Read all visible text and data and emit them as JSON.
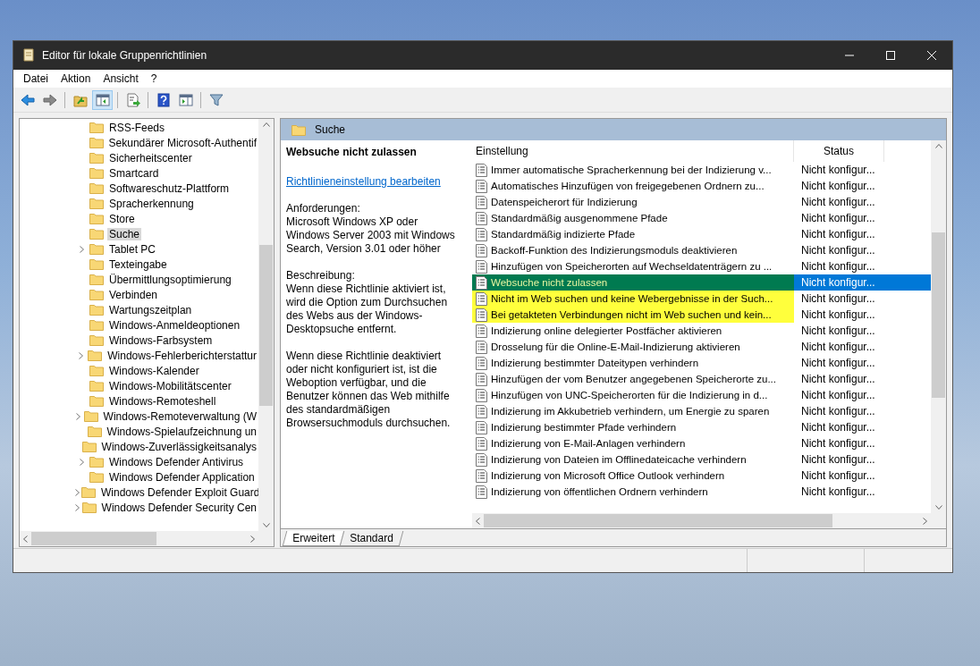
{
  "window": {
    "title": "Editor für lokale Gruppenrichtlinien"
  },
  "menu": [
    "Datei",
    "Aktion",
    "Ansicht",
    "?"
  ],
  "toolbar": [
    {
      "kind": "back",
      "pressed": false
    },
    {
      "kind": "forward",
      "pressed": false
    },
    {
      "kind": "sep"
    },
    {
      "kind": "up",
      "pressed": false
    },
    {
      "kind": "tree",
      "pressed": true
    },
    {
      "kind": "sep"
    },
    {
      "kind": "export",
      "pressed": false
    },
    {
      "kind": "sep"
    },
    {
      "kind": "help",
      "pressed": false
    },
    {
      "kind": "pane",
      "pressed": false
    },
    {
      "kind": "sep"
    },
    {
      "kind": "filter",
      "pressed": false
    }
  ],
  "tree": {
    "items": [
      {
        "label": "RSS-Feeds",
        "has_children": false,
        "selected": false
      },
      {
        "label": "Sekundärer Microsoft-Authentif",
        "has_children": false,
        "selected": false
      },
      {
        "label": "Sicherheitscenter",
        "has_children": false,
        "selected": false
      },
      {
        "label": "Smartcard",
        "has_children": false,
        "selected": false
      },
      {
        "label": "Softwareschutz-Plattform",
        "has_children": false,
        "selected": false
      },
      {
        "label": "Spracherkennung",
        "has_children": false,
        "selected": false
      },
      {
        "label": "Store",
        "has_children": false,
        "selected": false
      },
      {
        "label": "Suche",
        "has_children": false,
        "selected": true
      },
      {
        "label": "Tablet PC",
        "has_children": true,
        "selected": false
      },
      {
        "label": "Texteingabe",
        "has_children": false,
        "selected": false
      },
      {
        "label": "Übermittlungsoptimierung",
        "has_children": false,
        "selected": false
      },
      {
        "label": "Verbinden",
        "has_children": false,
        "selected": false
      },
      {
        "label": "Wartungszeitplan",
        "has_children": false,
        "selected": false
      },
      {
        "label": "Windows-Anmeldeoptionen",
        "has_children": false,
        "selected": false
      },
      {
        "label": "Windows-Farbsystem",
        "has_children": false,
        "selected": false
      },
      {
        "label": "Windows-Fehlerberichterstattur",
        "has_children": true,
        "selected": false
      },
      {
        "label": "Windows-Kalender",
        "has_children": false,
        "selected": false
      },
      {
        "label": "Windows-Mobilitätscenter",
        "has_children": false,
        "selected": false
      },
      {
        "label": "Windows-Remoteshell",
        "has_children": false,
        "selected": false
      },
      {
        "label": "Windows-Remoteverwaltung (W",
        "has_children": true,
        "selected": false
      },
      {
        "label": "Windows-Spielaufzeichnung un",
        "has_children": false,
        "selected": false
      },
      {
        "label": "Windows-Zuverlässigkeitsanalys",
        "has_children": false,
        "selected": false
      },
      {
        "label": "Windows Defender Antivirus",
        "has_children": true,
        "selected": false
      },
      {
        "label": "Windows Defender Application",
        "has_children": false,
        "selected": false
      },
      {
        "label": "Windows Defender Exploit Guard",
        "has_children": true,
        "selected": false
      },
      {
        "label": "Windows Defender Security Cen",
        "has_children": true,
        "selected": false
      }
    ]
  },
  "details": {
    "header": "Suche",
    "title": "Websuche nicht zulassen",
    "link": "Richtlinieneinstellung bearbeiten",
    "requirements_label": "Anforderungen:",
    "requirements": "Microsoft Windows XP oder Windows Server 2003 mit Windows Search, Version 3.01 oder höher",
    "description_label": "Beschreibung:",
    "description": [
      "Wenn diese Richtlinie aktiviert ist, wird die Option zum Durchsuchen des Webs aus der Windows-Desktopsuche entfernt.",
      "Wenn diese Richtlinie deaktiviert oder nicht konfiguriert ist, ist die Weboption verfügbar, und die Benutzer können das Web mithilfe des standardmäßigen Browsersuchmoduls durchsuchen."
    ]
  },
  "table": {
    "columns": [
      "Einstellung",
      "Status"
    ],
    "rows": [
      {
        "setting": "Immer automatische Spracherkennung bei der Indizierung v...",
        "status": "Nicht konfigur...",
        "selected": false,
        "highlighted": false
      },
      {
        "setting": "Automatisches Hinzufügen von freigegebenen Ordnern zu...",
        "status": "Nicht konfigur...",
        "selected": false,
        "highlighted": false
      },
      {
        "setting": "Datenspeicherort für Indizierung",
        "status": "Nicht konfigur...",
        "selected": false,
        "highlighted": false
      },
      {
        "setting": "Standardmäßig ausgenommene Pfade",
        "status": "Nicht konfigur...",
        "selected": false,
        "highlighted": false
      },
      {
        "setting": "Standardmäßig indizierte Pfade",
        "status": "Nicht konfigur...",
        "selected": false,
        "highlighted": false
      },
      {
        "setting": "Backoff-Funktion des Indizierungsmoduls deaktivieren",
        "status": "Nicht konfigur...",
        "selected": false,
        "highlighted": false
      },
      {
        "setting": "Hinzufügen von Speicherorten auf Wechseldatenträgern zu ...",
        "status": "Nicht konfigur...",
        "selected": false,
        "highlighted": false
      },
      {
        "setting": "Websuche nicht zulassen",
        "status": "Nicht konfigur...",
        "selected": true,
        "highlighted": true
      },
      {
        "setting": "Nicht im Web suchen und keine Webergebnisse in der Such...",
        "status": "Nicht konfigur...",
        "selected": false,
        "highlighted": true
      },
      {
        "setting": "Bei getakteten Verbindungen nicht im Web suchen und kein...",
        "status": "Nicht konfigur...",
        "selected": false,
        "highlighted": true
      },
      {
        "setting": "Indizierung online delegierter Postfächer aktivieren",
        "status": "Nicht konfigur...",
        "selected": false,
        "highlighted": false
      },
      {
        "setting": "Drosselung für die Online-E-Mail-Indizierung aktivieren",
        "status": "Nicht konfigur...",
        "selected": false,
        "highlighted": false
      },
      {
        "setting": "Indizierung bestimmter Dateitypen verhindern",
        "status": "Nicht konfigur...",
        "selected": false,
        "highlighted": false
      },
      {
        "setting": "Hinzufügen der vom Benutzer angegebenen Speicherorte zu...",
        "status": "Nicht konfigur...",
        "selected": false,
        "highlighted": false
      },
      {
        "setting": "Hinzufügen von UNC-Speicherorten für die Indizierung in d...",
        "status": "Nicht konfigur...",
        "selected": false,
        "highlighted": false
      },
      {
        "setting": "Indizierung im Akkubetrieb verhindern, um Energie zu sparen",
        "status": "Nicht konfigur...",
        "selected": false,
        "highlighted": false
      },
      {
        "setting": "Indizierung bestimmter Pfade verhindern",
        "status": "Nicht konfigur...",
        "selected": false,
        "highlighted": false
      },
      {
        "setting": "Indizierung von E-Mail-Anlagen verhindern",
        "status": "Nicht konfigur...",
        "selected": false,
        "highlighted": false
      },
      {
        "setting": "Indizierung von Dateien im Offlinedateicache verhindern",
        "status": "Nicht konfigur...",
        "selected": false,
        "highlighted": false
      },
      {
        "setting": "Indizierung von Microsoft Office Outlook verhindern",
        "status": "Nicht konfigur...",
        "selected": false,
        "highlighted": false
      },
      {
        "setting": "Indizierung von öffentlichen Ordnern verhindern",
        "status": "Nicht konfigur...",
        "selected": false,
        "highlighted": false
      }
    ]
  },
  "tabs": [
    {
      "label": "Erweitert",
      "selected": true
    },
    {
      "label": "Standard",
      "selected": false
    }
  ]
}
